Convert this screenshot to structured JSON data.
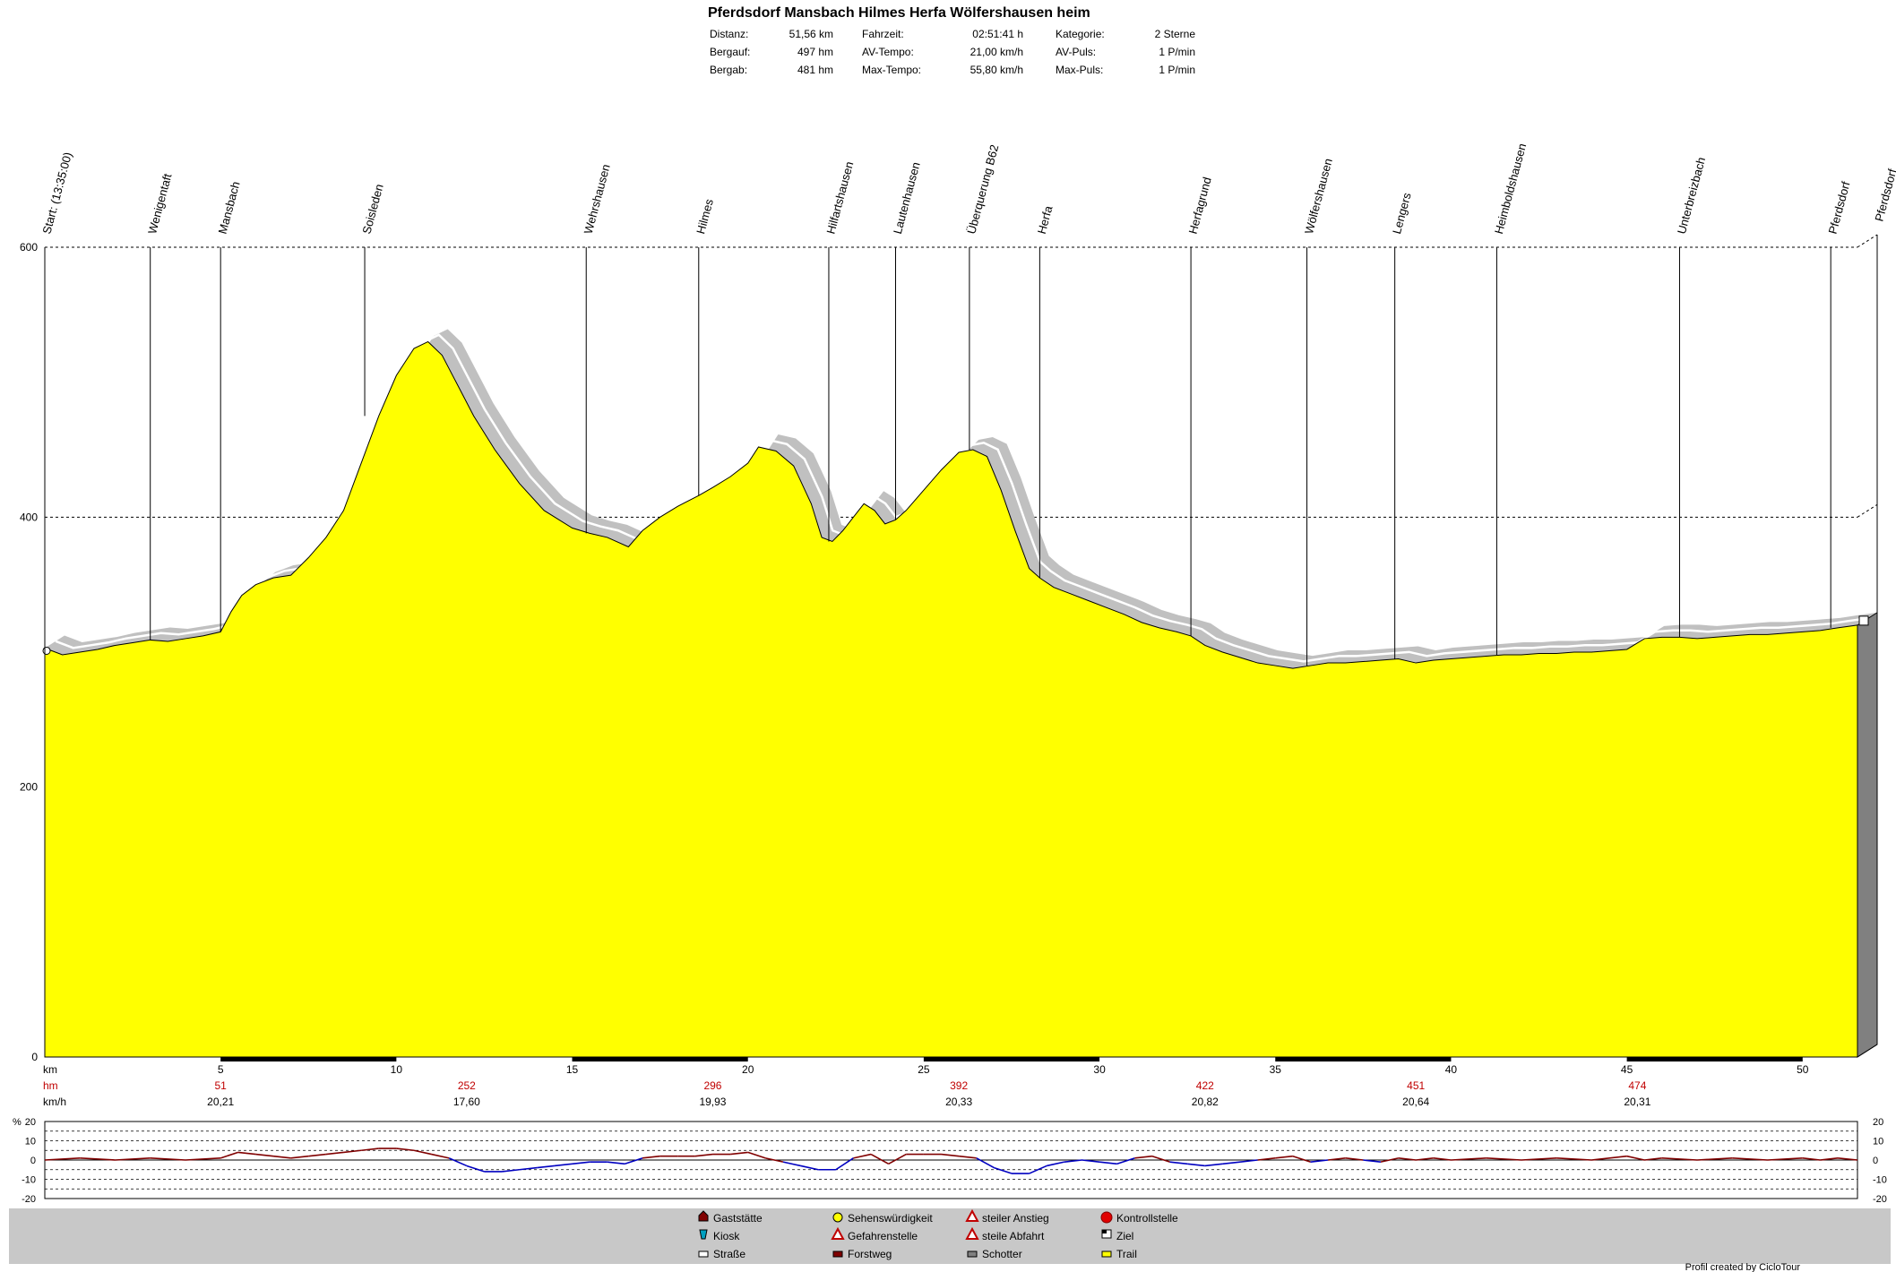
{
  "header": {
    "title": "Pferdsdorf Mansbach Hilmes Herfa Wölfershausen heim",
    "stats": [
      [
        "Distanz:",
        "51,56 km",
        "Fahrzeit:",
        "02:51:41 h",
        "Kategorie:",
        "2 Sterne"
      ],
      [
        "Bergauf:",
        "497 hm",
        "AV-Tempo:",
        "21,00 km/h",
        "AV-Puls:",
        "1 P/min"
      ],
      [
        "Bergab:",
        "481 hm",
        "Max-Tempo:",
        "55,80 km/h",
        "Max-Puls:",
        "1 P/min"
      ]
    ]
  },
  "colors": {
    "profile_fill": "#ffff00",
    "shadow": "#c0c0c0",
    "side_face": "#808080",
    "legend_bg": "#c8c8c8",
    "grade_up": "#800000",
    "grade_down": "#0000c0",
    "red_text": "#c00000"
  },
  "waypoints": [
    {
      "name": "Start: (13:35:00)",
      "km": 0
    },
    {
      "name": "Wenigentaft",
      "km": 3.0
    },
    {
      "name": "Mansbach",
      "km": 5.0
    },
    {
      "name": "Soisleden",
      "km": 9.1
    },
    {
      "name": "Wehrshausen",
      "km": 15.4
    },
    {
      "name": "Hilmes",
      "km": 18.6
    },
    {
      "name": "Hilfartshausen",
      "km": 22.3
    },
    {
      "name": "Lautenhausen",
      "km": 24.2
    },
    {
      "name": "Überquerung B62",
      "km": 26.3
    },
    {
      "name": "Herfa",
      "km": 28.3
    },
    {
      "name": "Herfagrund",
      "km": 32.6
    },
    {
      "name": "Wölfershausen",
      "km": 35.9
    },
    {
      "name": "Lengers",
      "km": 38.4
    },
    {
      "name": "Heimboldshausen",
      "km": 41.3
    },
    {
      "name": "Unterbreizbach",
      "km": 46.5
    },
    {
      "name": "Pferdsdorf",
      "km": 50.8
    },
    {
      "name": "Pferdsdorf",
      "km": 51.56
    }
  ],
  "chart_data": [
    {
      "type": "area",
      "title": "Pferdsdorf Mansbach Hilmes Herfa Wölfershausen heim",
      "xlabel": "km",
      "ylabel": "",
      "xlim": [
        0,
        51.56
      ],
      "ylim": [
        0,
        600
      ],
      "x_ticks": [
        5,
        10,
        15,
        20,
        25,
        30,
        35,
        40,
        45,
        50
      ],
      "y_ticks": [
        0,
        200,
        400,
        600
      ],
      "grid": true,
      "series": [
        {
          "x": [
            0,
            0.5,
            1,
            1.5,
            2,
            2.5,
            3,
            3.5,
            4,
            4.5,
            5,
            5.3,
            5.6,
            6,
            6.5,
            7,
            7.5,
            8,
            8.5,
            9,
            9.5,
            10,
            10.5,
            10.9,
            11.3,
            11.7,
            12.2,
            12.8,
            13.5,
            14.2,
            15,
            15.5,
            16,
            16.6,
            17,
            17.5,
            18,
            18.6,
            19,
            19.5,
            20,
            20.3,
            20.8,
            21.3,
            21.8,
            22.1,
            22.4,
            22.7,
            23,
            23.3,
            23.6,
            23.9,
            24.2,
            24.5,
            25,
            25.5,
            26,
            26.4,
            26.8,
            27.2,
            27.6,
            28,
            28.3,
            28.7,
            29.2,
            29.7,
            30.2,
            30.7,
            31.2,
            31.7,
            32.2,
            32.6,
            33,
            33.5,
            34,
            34.5,
            35,
            35.5,
            36,
            36.5,
            37,
            37.5,
            38,
            38.5,
            39,
            39.5,
            40,
            40.5,
            41,
            41.5,
            42,
            42.5,
            43,
            43.5,
            44,
            44.5,
            45,
            45.5,
            46,
            46.5,
            47,
            47.5,
            48,
            48.5,
            49,
            49.5,
            50,
            50.5,
            51,
            51.56
          ],
          "y": [
            303,
            298,
            300,
            302,
            305,
            307,
            309,
            308,
            310,
            312,
            315,
            330,
            342,
            350,
            355,
            357,
            370,
            385,
            405,
            440,
            475,
            505,
            525,
            530,
            520,
            500,
            475,
            450,
            425,
            405,
            392,
            388,
            385,
            378,
            390,
            400,
            408,
            416,
            422,
            430,
            440,
            452,
            449,
            438,
            410,
            385,
            382,
            390,
            400,
            410,
            405,
            395,
            398,
            405,
            420,
            435,
            448,
            450,
            445,
            420,
            390,
            362,
            355,
            348,
            343,
            338,
            333,
            328,
            322,
            318,
            315,
            312,
            305,
            300,
            296,
            292,
            290,
            288,
            290,
            292,
            292,
            293,
            294,
            295,
            292,
            294,
            295,
            296,
            297,
            298,
            298,
            299,
            299,
            300,
            300,
            301,
            302,
            310,
            311,
            311,
            310,
            311,
            312,
            313,
            313,
            314,
            315,
            316,
            318,
            320
          ],
          "name": ""
        }
      ]
    },
    {
      "type": "line",
      "title": "",
      "xlabel": "",
      "ylabel": "%",
      "xlim": [
        0,
        51.56
      ],
      "ylim": [
        -20,
        20
      ],
      "y_ticks": [
        20,
        10,
        0,
        -10,
        -20
      ],
      "series": [
        {
          "x": [
            0,
            1,
            2,
            3,
            4,
            5,
            5.5,
            6,
            6.5,
            7,
            7.5,
            8,
            8.5,
            9,
            9.5,
            10,
            10.5,
            11,
            11.5,
            12,
            12.5,
            13,
            13.5,
            14,
            14.5,
            15,
            15.5,
            16,
            16.5,
            17,
            17.5,
            18,
            18.5,
            19,
            19.5,
            20,
            20.5,
            21,
            21.5,
            22,
            22.5,
            23,
            23.5,
            24,
            24.5,
            25,
            25.5,
            26,
            26.5,
            27,
            27.5,
            28,
            28.5,
            29,
            29.5,
            30,
            30.5,
            31,
            31.5,
            32,
            32.5,
            33,
            33.5,
            34,
            34.5,
            35,
            35.5,
            36,
            36.5,
            37,
            37.5,
            38,
            38.5,
            39,
            39.5,
            40,
            41,
            42,
            43,
            44,
            45,
            45.5,
            46,
            47,
            48,
            49,
            50,
            50.5,
            51,
            51.56
          ],
          "y": [
            0,
            1,
            0,
            1,
            0,
            1,
            4,
            3,
            2,
            1,
            2,
            3,
            4,
            5,
            6,
            6,
            5,
            3,
            1,
            -3,
            -6,
            -6,
            -5,
            -4,
            -3,
            -2,
            -1,
            -1,
            -2,
            1,
            2,
            2,
            2,
            3,
            3,
            4,
            1,
            -1,
            -3,
            -5,
            -5,
            1,
            3,
            -2,
            3,
            3,
            3,
            2,
            1,
            -4,
            -7,
            -7,
            -3,
            -1,
            0,
            -1,
            -2,
            1,
            2,
            -1,
            -2,
            -3,
            -2,
            -1,
            0,
            1,
            2,
            -1,
            0,
            1,
            0,
            -1,
            1,
            0,
            1,
            0,
            1,
            0,
            1,
            0,
            2,
            0,
            1,
            0,
            1,
            0,
            1,
            0,
            1,
            0
          ],
          "name": ""
        }
      ]
    }
  ],
  "bottom_rows": {
    "km_label": "km",
    "hm_label": "hm",
    "kmh_label": "km/h",
    "hm_values": [
      {
        "km": 5,
        "v": "51"
      },
      {
        "km": 12,
        "v": "252"
      },
      {
        "km": 19,
        "v": "296"
      },
      {
        "km": 26,
        "v": "392"
      },
      {
        "km": 33,
        "v": "422"
      },
      {
        "km": 39,
        "v": "451"
      },
      {
        "km": 45.3,
        "v": "474"
      }
    ],
    "kmh_values": [
      {
        "km": 5,
        "v": "20,21"
      },
      {
        "km": 12,
        "v": "17,60"
      },
      {
        "km": 19,
        "v": "19,93"
      },
      {
        "km": 26,
        "v": "20,33"
      },
      {
        "km": 33,
        "v": "20,82"
      },
      {
        "km": 39,
        "v": "20,64"
      },
      {
        "km": 45.3,
        "v": "20,31"
      }
    ]
  },
  "grade_axis": {
    "percent_label": "%",
    "left_ticks": [
      "20",
      "10",
      "0",
      "-10",
      "-20"
    ],
    "right_ticks": [
      "20",
      "10",
      "0",
      "-10",
      "-20"
    ]
  },
  "legend": {
    "items": [
      {
        "label": "Gaststätte",
        "icon": "house-icon"
      },
      {
        "label": "Kiosk",
        "icon": "kiosk-icon"
      },
      {
        "label": "Straße",
        "icon": "road-swatch-icon"
      },
      {
        "label": "Sehenswürdigkeit",
        "icon": "smiley-icon"
      },
      {
        "label": "Gefahrenstelle",
        "icon": "warning-icon"
      },
      {
        "label": "Forstweg",
        "icon": "forest-road-swatch-icon"
      },
      {
        "label": "steiler Anstieg",
        "icon": "steep-climb-icon"
      },
      {
        "label": "steile Abfahrt",
        "icon": "steep-descent-icon"
      },
      {
        "label": "Schotter",
        "icon": "gravel-swatch-icon"
      },
      {
        "label": "Kontrollstelle",
        "icon": "stop-icon"
      },
      {
        "label": "Ziel",
        "icon": "finish-flag-icon"
      },
      {
        "label": "Trail",
        "icon": "trail-swatch-icon"
      }
    ]
  },
  "footer": {
    "credit": "Profil created by CicloTour"
  }
}
